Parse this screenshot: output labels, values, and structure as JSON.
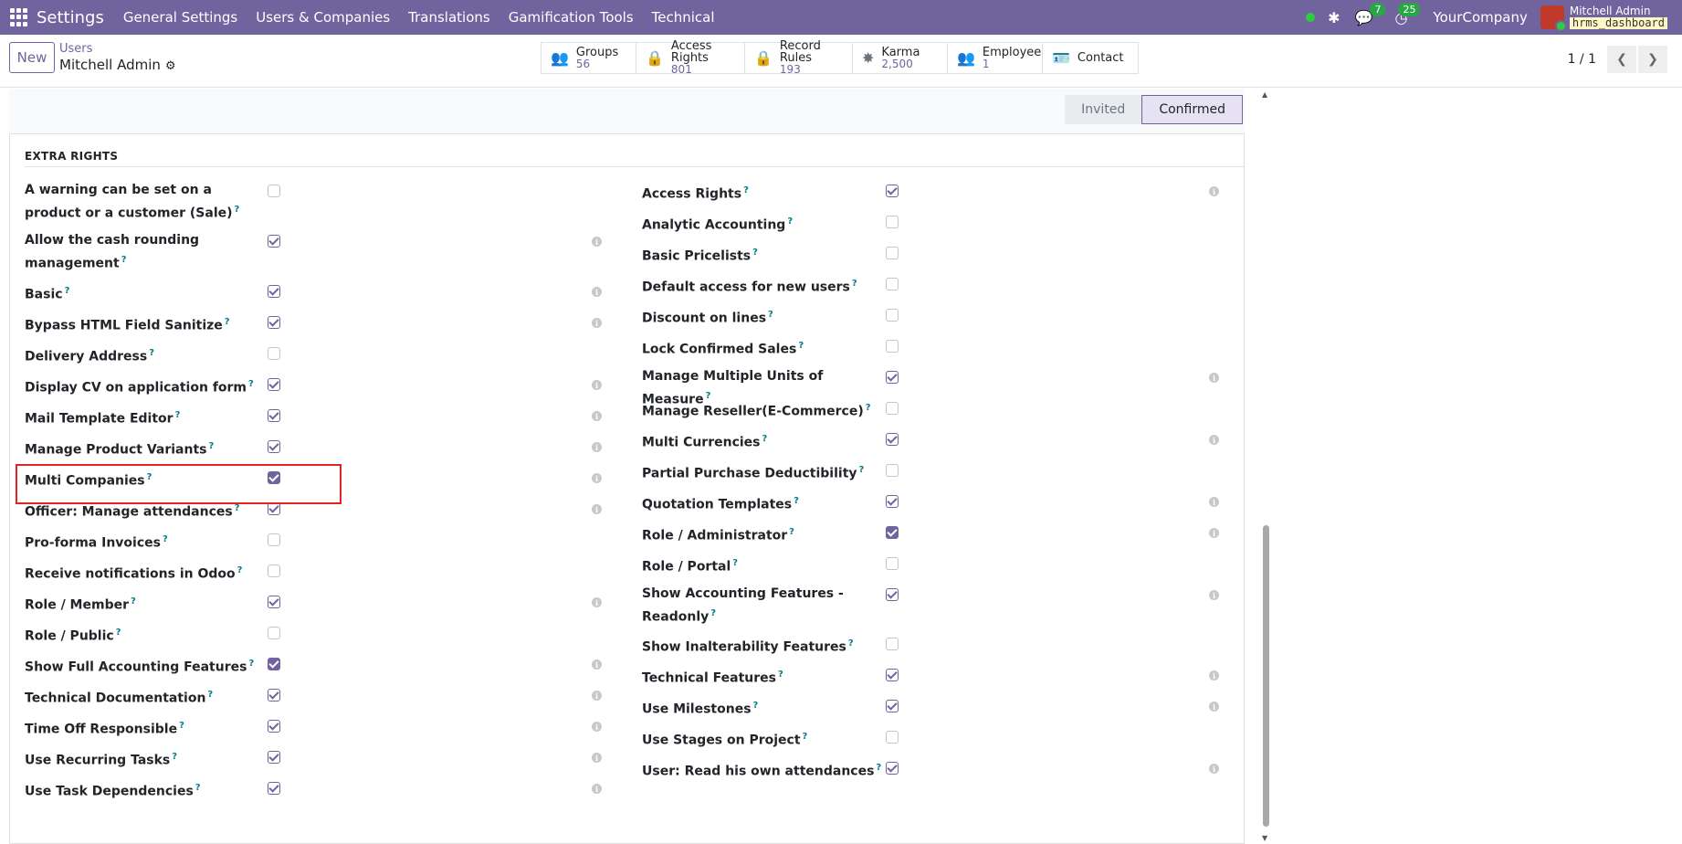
{
  "navbar": {
    "brand": "Settings",
    "menu": [
      "General Settings",
      "Users & Companies",
      "Translations",
      "Gamification Tools",
      "Technical"
    ],
    "chat_badge": "7",
    "activity_badge": "25",
    "company": "YourCompany",
    "user_name": "Mitchell Admin",
    "database": "hrms_dashboard"
  },
  "control": {
    "new_label": "New",
    "breadcrumb_parent": "Users",
    "breadcrumb_current": "Mitchell Admin",
    "smart_buttons": [
      {
        "label": "Groups",
        "value": "56",
        "icon": "users-icon"
      },
      {
        "label": "Access Rights",
        "value": "801",
        "icon": "lock-icon"
      },
      {
        "label": "Record Rules",
        "value": "193",
        "icon": "lock-icon"
      },
      {
        "label": "Karma",
        "value": "2,500",
        "icon": "badge-icon"
      },
      {
        "label": "Employee",
        "value": "1",
        "icon": "users-icon"
      },
      {
        "label": "Contact",
        "value": "",
        "icon": "id-card-icon"
      }
    ],
    "pager": "1 / 1"
  },
  "status": {
    "invited": "Invited",
    "confirmed": "Confirmed"
  },
  "section": {
    "title": "EXTRA RIGHTS"
  },
  "left_col": [
    {
      "label": "A warning can be set on a product or a customer (Sale)",
      "checked": false,
      "info": false,
      "filled": false
    },
    {
      "label": "Allow the cash rounding management",
      "checked": true,
      "info": true,
      "filled": false
    },
    {
      "label": "Basic",
      "checked": true,
      "info": true,
      "filled": false
    },
    {
      "label": "Bypass HTML Field Sanitize",
      "checked": true,
      "info": true,
      "filled": false
    },
    {
      "label": "Delivery Address",
      "checked": false,
      "info": false,
      "filled": false
    },
    {
      "label": "Display CV on application form",
      "checked": true,
      "info": true,
      "filled": false
    },
    {
      "label": "Mail Template Editor",
      "checked": true,
      "info": true,
      "filled": false
    },
    {
      "label": "Manage Product Variants",
      "checked": true,
      "info": true,
      "filled": false
    },
    {
      "label": "Multi Companies",
      "checked": true,
      "info": true,
      "filled": true
    },
    {
      "label": "Officer: Manage attendances",
      "checked": true,
      "info": true,
      "filled": false
    },
    {
      "label": "Pro-forma Invoices",
      "checked": false,
      "info": false,
      "filled": false
    },
    {
      "label": "Receive notifications in Odoo",
      "checked": false,
      "info": false,
      "filled": false
    },
    {
      "label": "Role / Member",
      "checked": true,
      "info": true,
      "filled": false
    },
    {
      "label": "Role / Public",
      "checked": false,
      "info": false,
      "filled": false
    },
    {
      "label": "Show Full Accounting Features",
      "checked": true,
      "info": true,
      "filled": true
    },
    {
      "label": "Technical Documentation",
      "checked": true,
      "info": true,
      "filled": false
    },
    {
      "label": "Time Off Responsible",
      "checked": true,
      "info": true,
      "filled": false
    },
    {
      "label": "Use Recurring Tasks",
      "checked": true,
      "info": true,
      "filled": false
    },
    {
      "label": "Use Task Dependencies",
      "checked": true,
      "info": true,
      "filled": false
    }
  ],
  "right_col": [
    {
      "label": "Access Rights",
      "checked": true,
      "info": true,
      "filled": false
    },
    {
      "label": "Analytic Accounting",
      "checked": false,
      "info": false,
      "filled": false
    },
    {
      "label": "Basic Pricelists",
      "checked": false,
      "info": false,
      "filled": false
    },
    {
      "label": "Default access for new users",
      "checked": false,
      "info": false,
      "filled": false
    },
    {
      "label": "Discount on lines",
      "checked": false,
      "info": false,
      "filled": false
    },
    {
      "label": "Lock Confirmed Sales",
      "checked": false,
      "info": false,
      "filled": false
    },
    {
      "label": "Manage Multiple Units of Measure",
      "checked": true,
      "info": true,
      "filled": false
    },
    {
      "label": "Manage Reseller(E-Commerce)",
      "checked": false,
      "info": false,
      "filled": false
    },
    {
      "label": "Multi Currencies",
      "checked": true,
      "info": true,
      "filled": false
    },
    {
      "label": "Partial Purchase Deductibility",
      "checked": false,
      "info": false,
      "filled": false
    },
    {
      "label": "Quotation Templates",
      "checked": true,
      "info": true,
      "filled": false
    },
    {
      "label": "Role / Administrator",
      "checked": true,
      "info": true,
      "filled": true
    },
    {
      "label": "Role / Portal",
      "checked": false,
      "info": false,
      "filled": false
    },
    {
      "label": "Show Accounting Features - Readonly",
      "checked": true,
      "info": true,
      "filled": false
    },
    {
      "label": "Show Inalterability Features",
      "checked": false,
      "info": false,
      "filled": false
    },
    {
      "label": "Technical Features",
      "checked": true,
      "info": true,
      "filled": false
    },
    {
      "label": "Use Milestones",
      "checked": true,
      "info": true,
      "filled": false
    },
    {
      "label": "Use Stages on Project",
      "checked": false,
      "info": false,
      "filled": false
    },
    {
      "label": "User: Read his own attendances",
      "checked": true,
      "info": true,
      "filled": false
    }
  ]
}
